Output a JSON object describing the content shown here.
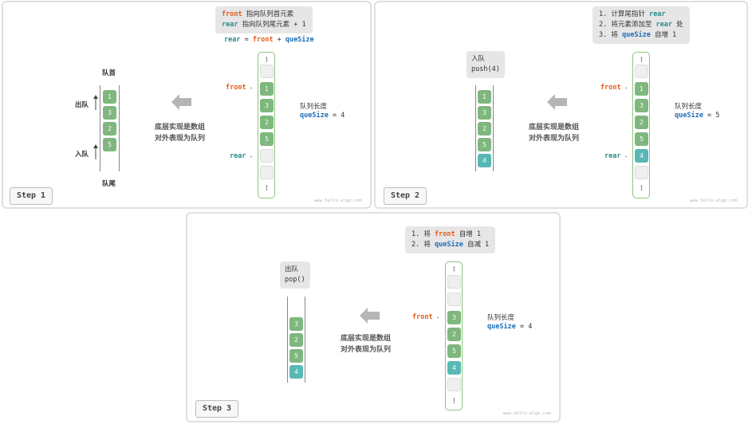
{
  "watermark": "www.hello-algo.com",
  "colors": {
    "green": "#7fb77e",
    "teal": "#58b8b5",
    "red": "#e45a1b",
    "blue": "#1a6fb8",
    "dark_teal": "#2a8c88"
  },
  "common": {
    "dots": "⋮",
    "front": "front",
    "rear": "rear",
    "que_size": "queSize",
    "que_len_label": "队列长度",
    "impl_line1": "底层实现是数组",
    "impl_line2": "对外表现为队列",
    "eq": "="
  },
  "step1": {
    "step_label": "Step 1",
    "note_line1_text": "指向队列首元素",
    "note_line2_text": "指向队列尾元素 + 1",
    "formula_eq": "=",
    "formula_plus": "+",
    "queue_head_label": "队首",
    "queue_tail_label": "队尾",
    "dequeue_label": "出队",
    "enqueue_label": "入队",
    "queue_values": [
      "1",
      "3",
      "2",
      "5"
    ],
    "array_values": [
      "1",
      "3",
      "2",
      "5"
    ],
    "que_size_value": "4"
  },
  "step2": {
    "step_label": "Step 2",
    "note_line1_text": "1. 计算尾指针",
    "note_line2_text": "2. 将元素添加至",
    "note_line2_suffix": "处",
    "note_line3_text": "3. 将",
    "note_line3_suffix": "自增 1",
    "op_label": "入队",
    "op_code": "push(4)",
    "queue_values": [
      "1",
      "3",
      "2",
      "5",
      "4"
    ],
    "array_values": [
      "1",
      "3",
      "2",
      "5",
      "4"
    ],
    "que_size_value": "5"
  },
  "step3": {
    "step_label": "Step 3",
    "note_line1_text": "1. 将",
    "note_line1_suffix": "自增 1",
    "note_line2_text": "2. 将",
    "note_line2_suffix": "自减 1",
    "op_label": "出队",
    "op_code": "pop()",
    "queue_values": [
      "3",
      "2",
      "5",
      "4"
    ],
    "array_values": [
      "3",
      "2",
      "5",
      "4"
    ],
    "que_size_value": "4"
  }
}
